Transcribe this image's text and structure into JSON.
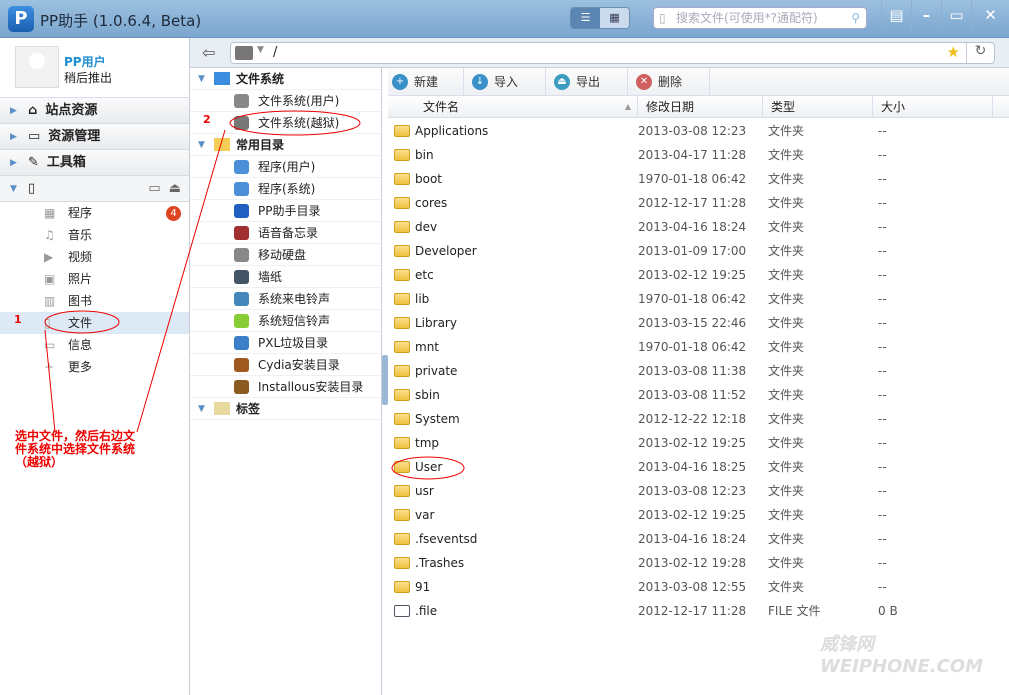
{
  "window": {
    "title": "PP助手 (1.0.6.4, Beta)",
    "search_placeholder": "搜索文件(可使用*?通配符)"
  },
  "user": {
    "name": "PP用户",
    "action": "稍后推出"
  },
  "sidebar": {
    "sections": [
      {
        "label": "站点资源"
      },
      {
        "label": "资源管理"
      },
      {
        "label": "工具箱"
      }
    ],
    "device_items": [
      {
        "label": "程序",
        "badge": "4"
      },
      {
        "label": "音乐"
      },
      {
        "label": "视频"
      },
      {
        "label": "照片"
      },
      {
        "label": "图书"
      },
      {
        "label": "文件"
      },
      {
        "label": "信息"
      },
      {
        "label": "更多"
      }
    ]
  },
  "path": {
    "value": "/"
  },
  "tree": {
    "groups": [
      {
        "label": "文件系统",
        "items": [
          {
            "label": "文件系统(用户)"
          },
          {
            "label": "文件系统(越狱)"
          }
        ]
      },
      {
        "label": "常用目录",
        "items": [
          {
            "label": "程序(用户)"
          },
          {
            "label": "程序(系统)"
          },
          {
            "label": "PP助手目录"
          },
          {
            "label": "语音备忘录"
          },
          {
            "label": "移动硬盘"
          },
          {
            "label": "墙纸"
          },
          {
            "label": "系统来电铃声"
          },
          {
            "label": "系统短信铃声"
          },
          {
            "label": "PXL垃圾目录"
          },
          {
            "label": "Cydia安装目录"
          },
          {
            "label": "Installous安装目录"
          }
        ]
      },
      {
        "label": "标签",
        "items": []
      }
    ]
  },
  "toolbar": {
    "new": "新建",
    "import": "导入",
    "export": "导出",
    "delete": "删除"
  },
  "table": {
    "columns": [
      "文件名",
      "修改日期",
      "类型",
      "大小"
    ],
    "rows": [
      [
        "Applications",
        "2013-03-08 12:23",
        "文件夹",
        "--"
      ],
      [
        "bin",
        "2013-04-17 11:28",
        "文件夹",
        "--"
      ],
      [
        "boot",
        "1970-01-18 06:42",
        "文件夹",
        "--"
      ],
      [
        "cores",
        "2012-12-17 11:28",
        "文件夹",
        "--"
      ],
      [
        "dev",
        "2013-04-16 18:24",
        "文件夹",
        "--"
      ],
      [
        "Developer",
        "2013-01-09 17:00",
        "文件夹",
        "--"
      ],
      [
        "etc",
        "2013-02-12 19:25",
        "文件夹",
        "--"
      ],
      [
        "lib",
        "1970-01-18 06:42",
        "文件夹",
        "--"
      ],
      [
        "Library",
        "2013-03-15 22:46",
        "文件夹",
        "--"
      ],
      [
        "mnt",
        "1970-01-18 06:42",
        "文件夹",
        "--"
      ],
      [
        "private",
        "2013-03-08 11:38",
        "文件夹",
        "--"
      ],
      [
        "sbin",
        "2013-03-08 11:52",
        "文件夹",
        "--"
      ],
      [
        "System",
        "2012-12-22 12:18",
        "文件夹",
        "--"
      ],
      [
        "tmp",
        "2013-02-12 19:25",
        "文件夹",
        "--"
      ],
      [
        "User",
        "2013-04-16 18:25",
        "文件夹",
        "--"
      ],
      [
        "usr",
        "2013-03-08 12:23",
        "文件夹",
        "--"
      ],
      [
        "var",
        "2013-02-12 19:25",
        "文件夹",
        "--"
      ],
      [
        ".fseventsd",
        "2013-04-16 18:24",
        "文件夹",
        "--"
      ],
      [
        ".Trashes",
        "2013-02-12 19:28",
        "文件夹",
        "--"
      ],
      [
        "91",
        "2013-03-08 12:55",
        "文件夹",
        "--"
      ],
      [
        ".file",
        "2012-12-17 11:28",
        "FILE 文件",
        "0 B"
      ]
    ]
  },
  "annotations": {
    "mark1": "1",
    "mark2": "2",
    "note": "选中文件，然后右边文件系统中选择文件系统（越狱）"
  },
  "watermark": "威锋网 WEIPHONE.COM",
  "colors": {
    "accent": "#1f8fd0",
    "annotation": "#ee0000",
    "titlebar": "#7ba6cf"
  }
}
